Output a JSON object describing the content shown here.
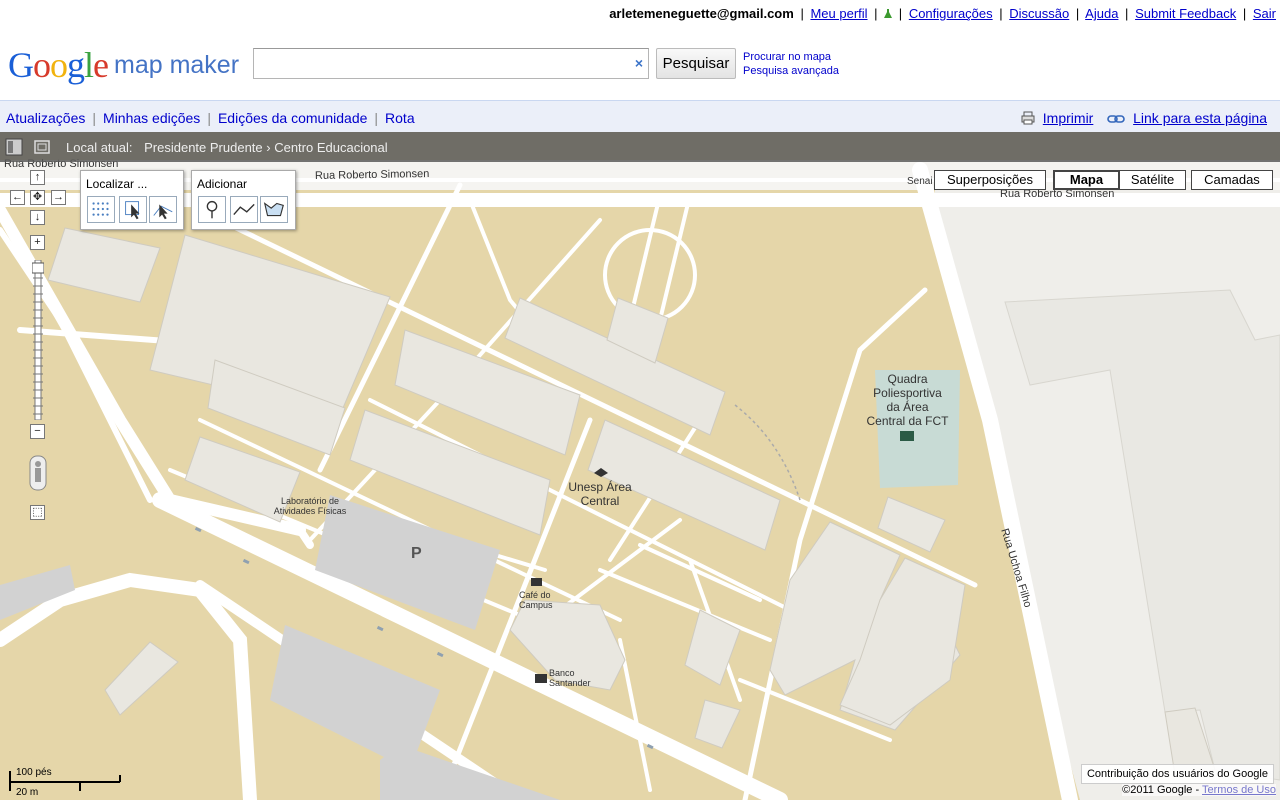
{
  "userbar": {
    "email": "arletemeneguette@gmail.com",
    "links": [
      "Meu perfil",
      "Configurações",
      "Discussão",
      "Ajuda",
      "Submit Feedback",
      "Sair"
    ]
  },
  "header": {
    "logo_google": "Google",
    "logo_product": "map maker",
    "search_value": "",
    "search_clear": "×",
    "search_button": "Pesquisar",
    "search_on_map": "Procurar no mapa",
    "advanced_search": "Pesquisa avançada"
  },
  "navbar": {
    "items": [
      "Atualizações",
      "Minhas edições",
      "Edições da comunidade",
      "Rota"
    ],
    "print": "Imprimir",
    "link": "Link para esta página"
  },
  "location": {
    "label": "Local atual:",
    "crumb": "Presidente Prudente › Centro Educacional"
  },
  "tools": {
    "locate_title": "Localizar ...",
    "add_title": "Adicionar"
  },
  "maptypes": {
    "overlays": "Superposições",
    "map": "Mapa",
    "satellite": "Satélite",
    "layers": "Camadas"
  },
  "map_labels": {
    "street_top_left": "Rua Roberto Simonsen",
    "street_top_mid": "Rua Roberto Simonsen",
    "street_top_right": "Rua Roberto Simonsen",
    "street_senai": "Senai",
    "street_right": "Rua Uchoa Filho",
    "quadra": [
      "Quadra",
      "Poliesportiva",
      "da Área",
      "Central da FCT"
    ],
    "unesp": [
      "Unesp Área",
      "Central"
    ],
    "lab": [
      "Laboratório de",
      "Atividades Físicas"
    ],
    "parking": "P",
    "cafe": [
      "Café do",
      "Campus"
    ],
    "banco": [
      "Banco",
      "Santander"
    ]
  },
  "scale": {
    "feet": "100 pés",
    "meters": "20 m"
  },
  "footer": {
    "contribution": "Contribuição dos usuários do Google",
    "copyright": "©2011 Google -",
    "terms": "Termos de Uso"
  },
  "colors": {
    "land": "#e5d6a9",
    "road": "#fefefe",
    "building": "#e9e7e0",
    "parking": "#d2d2d2",
    "court": "#c8dbd5",
    "link": "#0000cc",
    "nav_bg": "#ebeff9"
  }
}
